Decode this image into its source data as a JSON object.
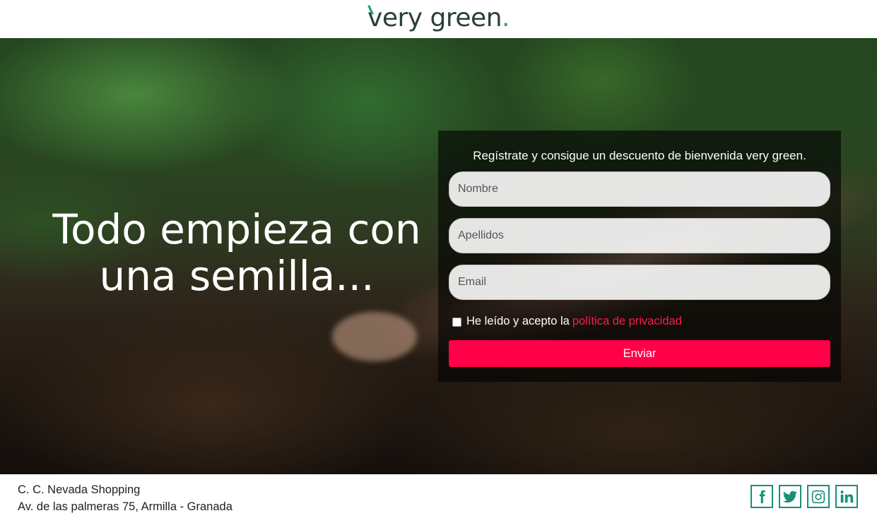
{
  "header": {
    "logo_word1_rest": "ery",
    "logo_word1_first": "v",
    "logo_word2": " green",
    "logo_dot": "."
  },
  "hero": {
    "headline_line1": "Todo empieza con",
    "headline_line2": "una semilla..."
  },
  "form": {
    "intro": "Regístrate y consigue un descuento de bienvenida very green.",
    "fields": [
      {
        "placeholder": "Nombre"
      },
      {
        "placeholder": "Apellidos"
      },
      {
        "placeholder": "Email"
      }
    ],
    "consent_text": "He leído y acepto la",
    "consent_link": "política de privacidad",
    "submit_label": "Enviar",
    "submit_color": "#ff0049"
  },
  "footer": {
    "address_line1": "C. C. Nevada Shopping",
    "address_line2": "Av. de las palmeras 75, Armilla - Granada",
    "socials": [
      {
        "icon": "facebook-icon"
      },
      {
        "icon": "twitter-icon"
      },
      {
        "icon": "instagram-icon"
      },
      {
        "icon": "linkedin-icon"
      }
    ],
    "social_color": "#1a8f78"
  }
}
